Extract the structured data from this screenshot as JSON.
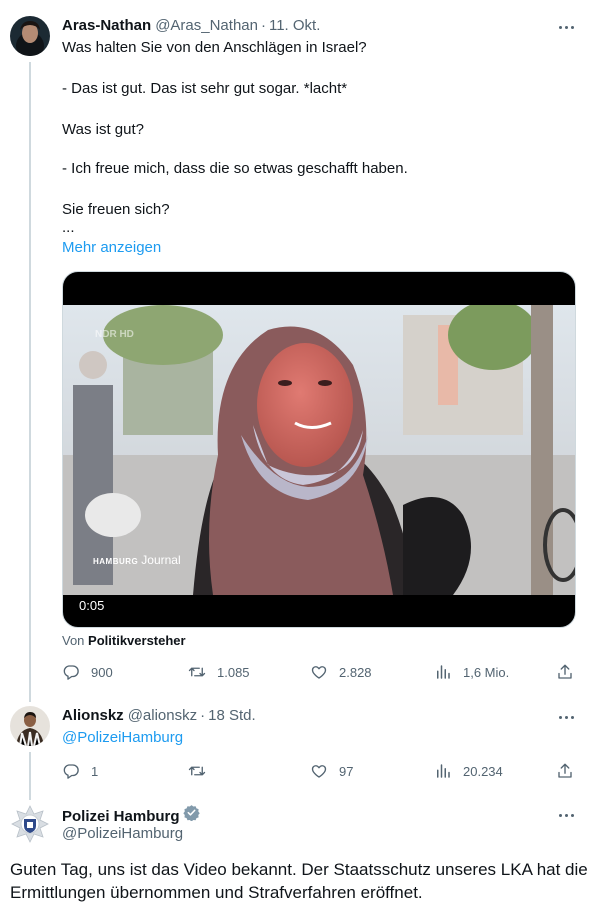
{
  "tweet1": {
    "name": "Aras-Nathan",
    "handle": "@Aras_Nathan",
    "separator": "·",
    "time": "11. Okt.",
    "lines": [
      "Was halten Sie von den Anschlägen in Israel?",
      "- Das ist gut. Das ist sehr gut sogar. *lacht*",
      "Was ist gut?",
      "- Ich freue mich, dass die so etwas geschafft haben.",
      "Sie freuen sich?",
      "..."
    ],
    "show_more": "Mehr anzeigen",
    "media": {
      "duration": "0:05",
      "watermark_top": "NDR HD",
      "watermark_brand": "HAMBURG",
      "watermark_show": "Journal"
    },
    "attribution_prefix": "Von",
    "attribution_name": "Politikversteher",
    "stats": {
      "replies": "900",
      "retweets": "1.085",
      "likes": "2.828",
      "views": "1,6 Mio."
    }
  },
  "tweet2": {
    "name": "Alionskz",
    "handle": "@alionskz",
    "separator": "·",
    "time": "18 Std.",
    "mention": "@PolizeiHamburg",
    "stats": {
      "replies": "1",
      "retweets": "",
      "likes": "97",
      "views": "20.234"
    }
  },
  "tweet3": {
    "name": "Polizei Hamburg",
    "handle": "@PolizeiHamburg",
    "text": "Guten Tag, uns ist das Video bekannt. Der Staatsschutz unseres LKA hat die Ermittlungen übernommen und Strafverfahren eröffnet."
  },
  "icons": {
    "reply": "reply-icon",
    "retweet": "retweet-icon",
    "like": "like-icon",
    "views": "views-icon",
    "share": "share-icon",
    "more": "more-icon",
    "verified": "verified-badge-icon"
  },
  "colors": {
    "link": "#1d9bf0",
    "text": "#0f1419",
    "secondary": "#536471",
    "verified_gray": "#829aab"
  }
}
